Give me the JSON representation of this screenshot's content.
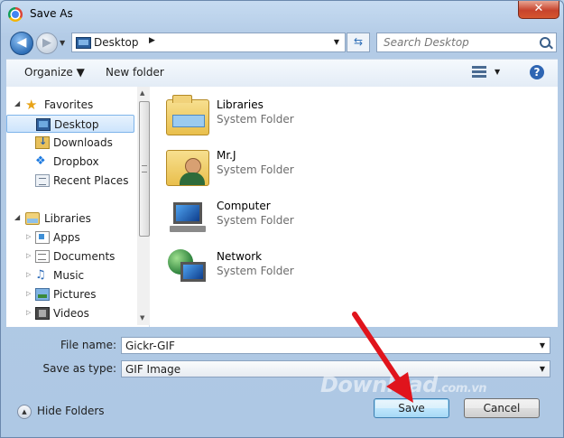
{
  "window": {
    "title": "Save As",
    "close_label": "✕"
  },
  "nav": {
    "back_glyph": "◀",
    "forward_glyph": "▶",
    "recent_glyph": "▼"
  },
  "address": {
    "location": "Desktop",
    "separator": "▶",
    "dropdown": "▼",
    "refresh_glyph": "⇆"
  },
  "search": {
    "placeholder": "Search Desktop"
  },
  "toolbar": {
    "organize_label": "Organize ▼",
    "new_folder_label": "New folder",
    "view_dropdown": "▼",
    "help_label": "?"
  },
  "sidebar": {
    "favorites": {
      "label": "Favorites",
      "items": [
        {
          "label": "Desktop",
          "icon": "desktop-icon",
          "selected": true
        },
        {
          "label": "Downloads",
          "icon": "downloads-icon"
        },
        {
          "label": "Dropbox",
          "icon": "dropbox-icon"
        },
        {
          "label": "Recent Places",
          "icon": "recent-places-icon"
        }
      ]
    },
    "libraries": {
      "label": "Libraries",
      "items": [
        {
          "label": "Apps",
          "icon": "apps-icon"
        },
        {
          "label": "Documents",
          "icon": "documents-icon"
        },
        {
          "label": "Music",
          "icon": "music-icon"
        },
        {
          "label": "Pictures",
          "icon": "pictures-icon"
        },
        {
          "label": "Videos",
          "icon": "videos-icon"
        }
      ]
    }
  },
  "files": [
    {
      "name": "Libraries",
      "type": "System Folder",
      "icon": "libraries-icon"
    },
    {
      "name": "Mr.J",
      "type": "System Folder",
      "icon": "user-folder-icon"
    },
    {
      "name": "Computer",
      "type": "System Folder",
      "icon": "computer-icon"
    },
    {
      "name": "Network",
      "type": "System Folder",
      "icon": "network-icon"
    }
  ],
  "form": {
    "file_name_label": "File name:",
    "file_name_value": "Gickr-GIF",
    "save_as_type_label": "Save as type:",
    "save_as_type_value": "GIF Image",
    "dropdown_glyph": "▼"
  },
  "footer": {
    "hide_folders_label": "Hide Folders",
    "hide_folders_glyph": "▲",
    "save_label": "Save",
    "cancel_label": "Cancel"
  },
  "watermark": {
    "text": "Download",
    "suffix": ".com.vn"
  },
  "colors": {
    "accent": "#2f6fb7",
    "selection": "#cde4fc",
    "arrow": "#e0141c"
  }
}
